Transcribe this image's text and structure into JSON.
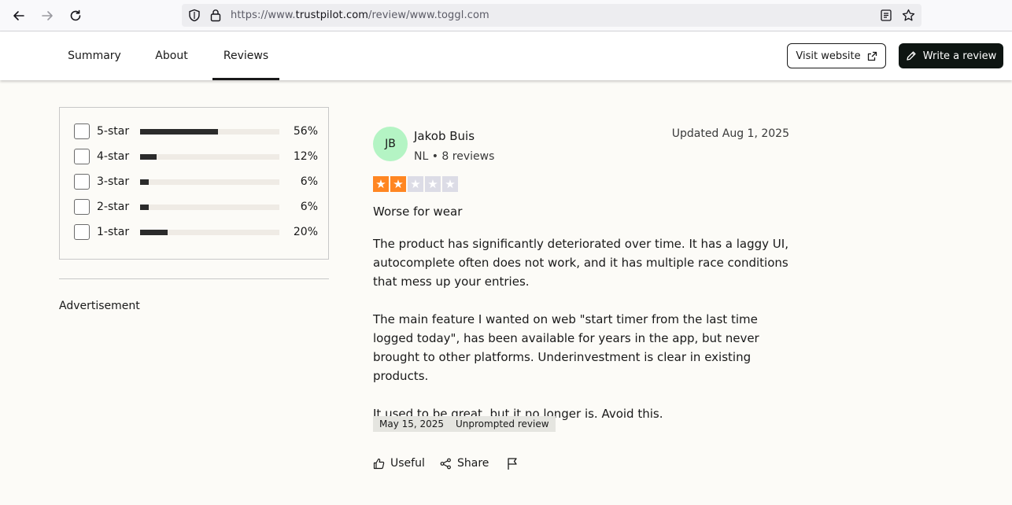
{
  "browser": {
    "url_prefix": "https://www.",
    "url_host": "trustpilot.com",
    "url_path": "/review/www.toggl.com"
  },
  "nav": {
    "tabs": [
      {
        "label": "Summary"
      },
      {
        "label": "About"
      },
      {
        "label": "Reviews",
        "active": true
      }
    ],
    "visit_label": "Visit website",
    "write_label": "Write a review"
  },
  "filters": [
    {
      "label": "5-star",
      "pct": "56%",
      "value": 0.56
    },
    {
      "label": "4-star",
      "pct": "12%",
      "value": 0.12
    },
    {
      "label": "3-star",
      "pct": "6%",
      "value": 0.06
    },
    {
      "label": "2-star",
      "pct": "6%",
      "value": 0.06
    },
    {
      "label": "1-star",
      "pct": "20%",
      "value": 0.2
    }
  ],
  "sidebar": {
    "advertisement": "Advertisement"
  },
  "review": {
    "initials": "JB",
    "author": "Jakob Buis",
    "meta": "NL • 8 reviews",
    "updated": "Updated Aug 1, 2025",
    "rating": 2,
    "rating_max": 5,
    "title": "Worse for wear",
    "body": [
      "The product has significantly deteriorated over time. It has a laggy UI, autocomplete often does not work, and it has multiple race conditions that mess up your entries.",
      "The main feature I wanted on web \"start timer from the last time logged today\", has been available for years in the app, but never brought to other platforms. Underinvestment is clear in existing products.",
      "It used to be great, but it no longer is. Avoid this."
    ],
    "date_tag": "May 15, 2025",
    "source_tag": "Unprompted review",
    "useful_label": "Useful",
    "share_label": "Share"
  },
  "colors": {
    "star_filled": "#ff8622",
    "star_empty": "#dcdce6",
    "avatar_bg": "#b4f4c4"
  }
}
